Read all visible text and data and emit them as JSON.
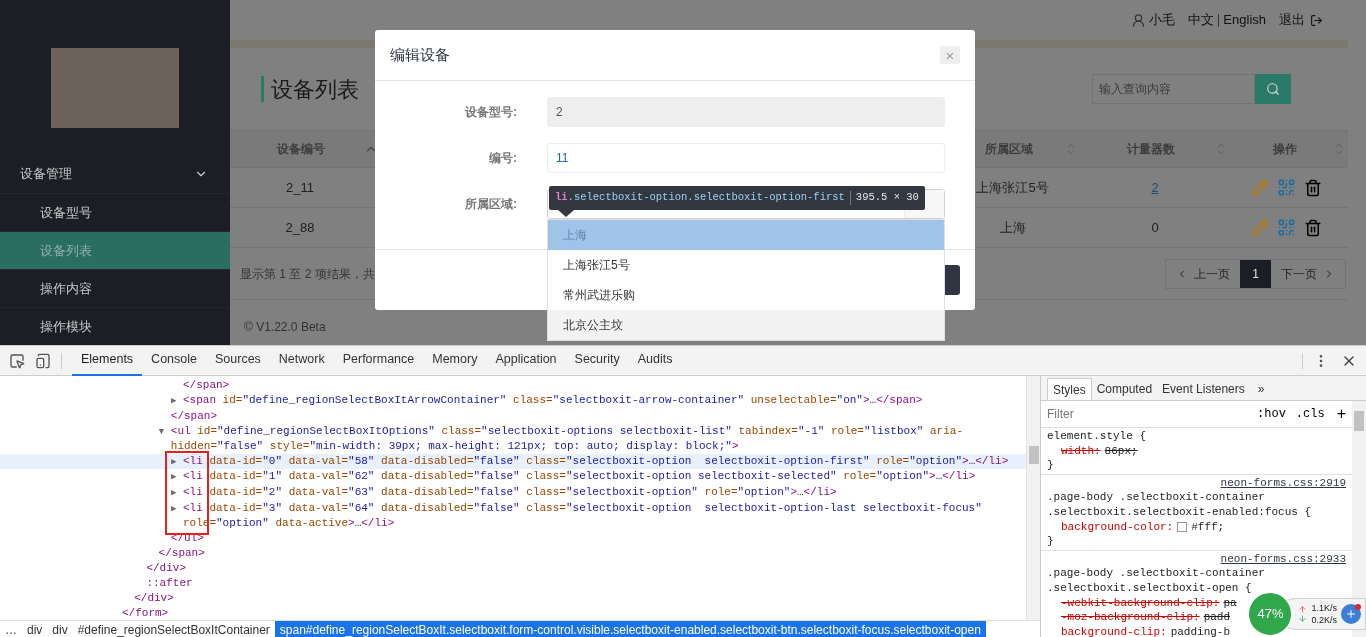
{
  "header": {
    "user": "小毛",
    "languages": [
      "中文",
      "English"
    ],
    "logout": "退出"
  },
  "sidebar": {
    "menu": [
      {
        "label": "设备管理",
        "expanded": true,
        "children": [
          {
            "label": "设备型号",
            "selected": false
          },
          {
            "label": "设备列表",
            "selected": true
          },
          {
            "label": "操作内容",
            "selected": false
          },
          {
            "label": "操作模块",
            "selected": false
          }
        ]
      }
    ]
  },
  "content": {
    "title": "设备列表",
    "search": {
      "placeholder": "输入查询内容"
    },
    "table": {
      "columns": [
        {
          "label": "设备编号",
          "sorted": true
        },
        {
          "label": "所属区域",
          "sorted": false
        },
        {
          "label": "计量器数",
          "sorted": false
        },
        {
          "label": "操作",
          "sorted": false
        }
      ],
      "rows": [
        {
          "code": "2_11",
          "region": "上海张江5号",
          "meters": "2",
          "meters_link": true
        },
        {
          "code": "2_88",
          "region": "上海",
          "meters": "0",
          "meters_link": false
        }
      ]
    },
    "summary": "显示第 1 至 2 项结果，共",
    "pagination": {
      "prev": "上一页",
      "pages": [
        {
          "label": "1",
          "selected": true
        }
      ],
      "next": "下一页"
    },
    "footer": "© V1.22.0 Beta"
  },
  "modal": {
    "title": "编辑设备",
    "close": "×",
    "fields": [
      {
        "kind": "input",
        "label": "设备型号:",
        "value": "2",
        "disabled": true
      },
      {
        "kind": "input",
        "label": "编号:",
        "value": "11",
        "disabled": false
      },
      {
        "kind": "select",
        "label": "所属区域:",
        "open": true,
        "options": [
          {
            "label": "上海",
            "inspected": true,
            "focused": false
          },
          {
            "label": "上海张江5号",
            "inspected": false,
            "focused": false
          },
          {
            "label": "常州武进乐购",
            "inspected": false,
            "focused": false
          },
          {
            "label": "北京公主坟",
            "inspected": false,
            "focused": true
          }
        ]
      }
    ]
  },
  "inspector_tooltip": {
    "tag": "li",
    "classes": ".selectboxit-option.selectboxit-option-first",
    "size": "395.5 × 30"
  },
  "devtools": {
    "tabs": [
      {
        "label": "Elements",
        "selected": true
      },
      {
        "label": "Console",
        "selected": false
      },
      {
        "label": "Sources",
        "selected": false
      },
      {
        "label": "Network",
        "selected": false
      },
      {
        "label": "Performance",
        "selected": false
      },
      {
        "label": "Memory",
        "selected": false
      },
      {
        "label": "Application",
        "selected": false
      },
      {
        "label": "Security",
        "selected": false
      },
      {
        "label": "Audits",
        "selected": false
      }
    ],
    "dom": [
      {
        "close": "</form>",
        "children": [
          {
            "close": "</div>",
            "children": [
              {
                "close": "</div>",
                "children": [
                  {
                    "close": "</span>",
                    "children": [
                      {
                        "close": "</span>",
                        "children": [
                          {
                            "close": "</span>"
                          },
                          {
                            "toggle": "▶",
                            "text": "<span id=\"define_regionSelectBoxItArrowContainer\" class=\"selectboxit-arrow-container\" unselectable=\"on\">…</span>",
                            "selected": false
                          }
                        ]
                      },
                      {
                        "toggle": "▼",
                        "text": "<ul id=\"define_regionSelectBoxItOptions\" class=\"selectboxit-options selectboxit-list\" tabindex=\"-1\" role=\"listbox\" aria-hidden=\"false\" style=\"min-width: 39px; max-height: 121px; top: auto; display: block;\">",
                        "selected": false,
                        "close": "</ul>",
                        "children": [
                          {
                            "toggle": "▶",
                            "text": "<li data-id=\"0\" data-val=\"58\" data-disabled=\"false\" class=\"selectboxit-option  selectboxit-option-first\" role=\"option\">…</li>",
                            "selected": true
                          },
                          {
                            "toggle": "▶",
                            "text": "<li data-id=\"1\" data-val=\"62\" data-disabled=\"false\" class=\"selectboxit-option selectboxit-selected\" role=\"option\">…</li>",
                            "selected": false
                          },
                          {
                            "toggle": "▶",
                            "text": "<li data-id=\"2\" data-val=\"63\" data-disabled=\"false\" class=\"selectboxit-option\" role=\"option\">…</li>",
                            "selected": false
                          },
                          {
                            "toggle": "▶",
                            "text": "<li data-id=\"3\" data-val=\"64\" data-disabled=\"false\" class=\"selectboxit-option  selectboxit-option-last selectboxit-focus\" role=\"option\" data-active>…</li>",
                            "selected": false
                          }
                        ]
                      }
                    ]
                  }
                ]
              },
              {
                "text": "::after",
                "selected": false
              }
            ]
          }
        ]
      }
    ],
    "breadcrumbs": [
      {
        "label": "…",
        "selected": false
      },
      {
        "label": "div",
        "selected": false
      },
      {
        "label": "div",
        "selected": false
      },
      {
        "label": "#define_regionSelectBoxItContainer",
        "selected": false
      },
      {
        "label": "span#define_regionSelectBoxIt.selectboxit.form-control.visible.selectboxit-enabled.selectboxit-btn.selectboxit-focus.selectboxit-open",
        "selected": true
      }
    ],
    "styles": {
      "tabs": [
        {
          "label": "Styles",
          "selected": true
        },
        {
          "label": "Computed",
          "selected": false
        },
        {
          "label": "Event Listeners",
          "selected": false
        }
      ],
      "more": "»",
      "filter": {
        "placeholder": "Filter"
      },
      "hov": ":hov",
      "cls": ".cls",
      "add": "+",
      "rules": [
        {
          "selector": "element.style {",
          "props": [
            {
              "name": "width:",
              "value": "86px;",
              "struck": true
            }
          ],
          "close": "}"
        },
        {
          "selector": ".page-body .selectboxit-container .selectboxit.selectboxit-enabled:focus {",
          "source": "neon-forms.css:2919",
          "props": [
            {
              "name": "background-color:",
              "value": "#fff;",
              "struck": false,
              "color": "#ffffff"
            }
          ],
          "close": "}"
        },
        {
          "selector": ".page-body .selectboxit-container .selectboxit.selectboxit-open {",
          "source": "neon-forms.css:2933",
          "props": [
            {
              "name": "-webkit-background-clip:",
              "value": "pa",
              "struck": true
            },
            {
              "name": "-moz-background-clip:",
              "value": "padd",
              "struck": true
            },
            {
              "name": "background-clip:",
              "value": "padding-b",
              "struck": false
            }
          ]
        }
      ]
    }
  },
  "network_widget": {
    "percent": "47%",
    "upload": "1.1K/s",
    "download": "0.2K/s"
  }
}
